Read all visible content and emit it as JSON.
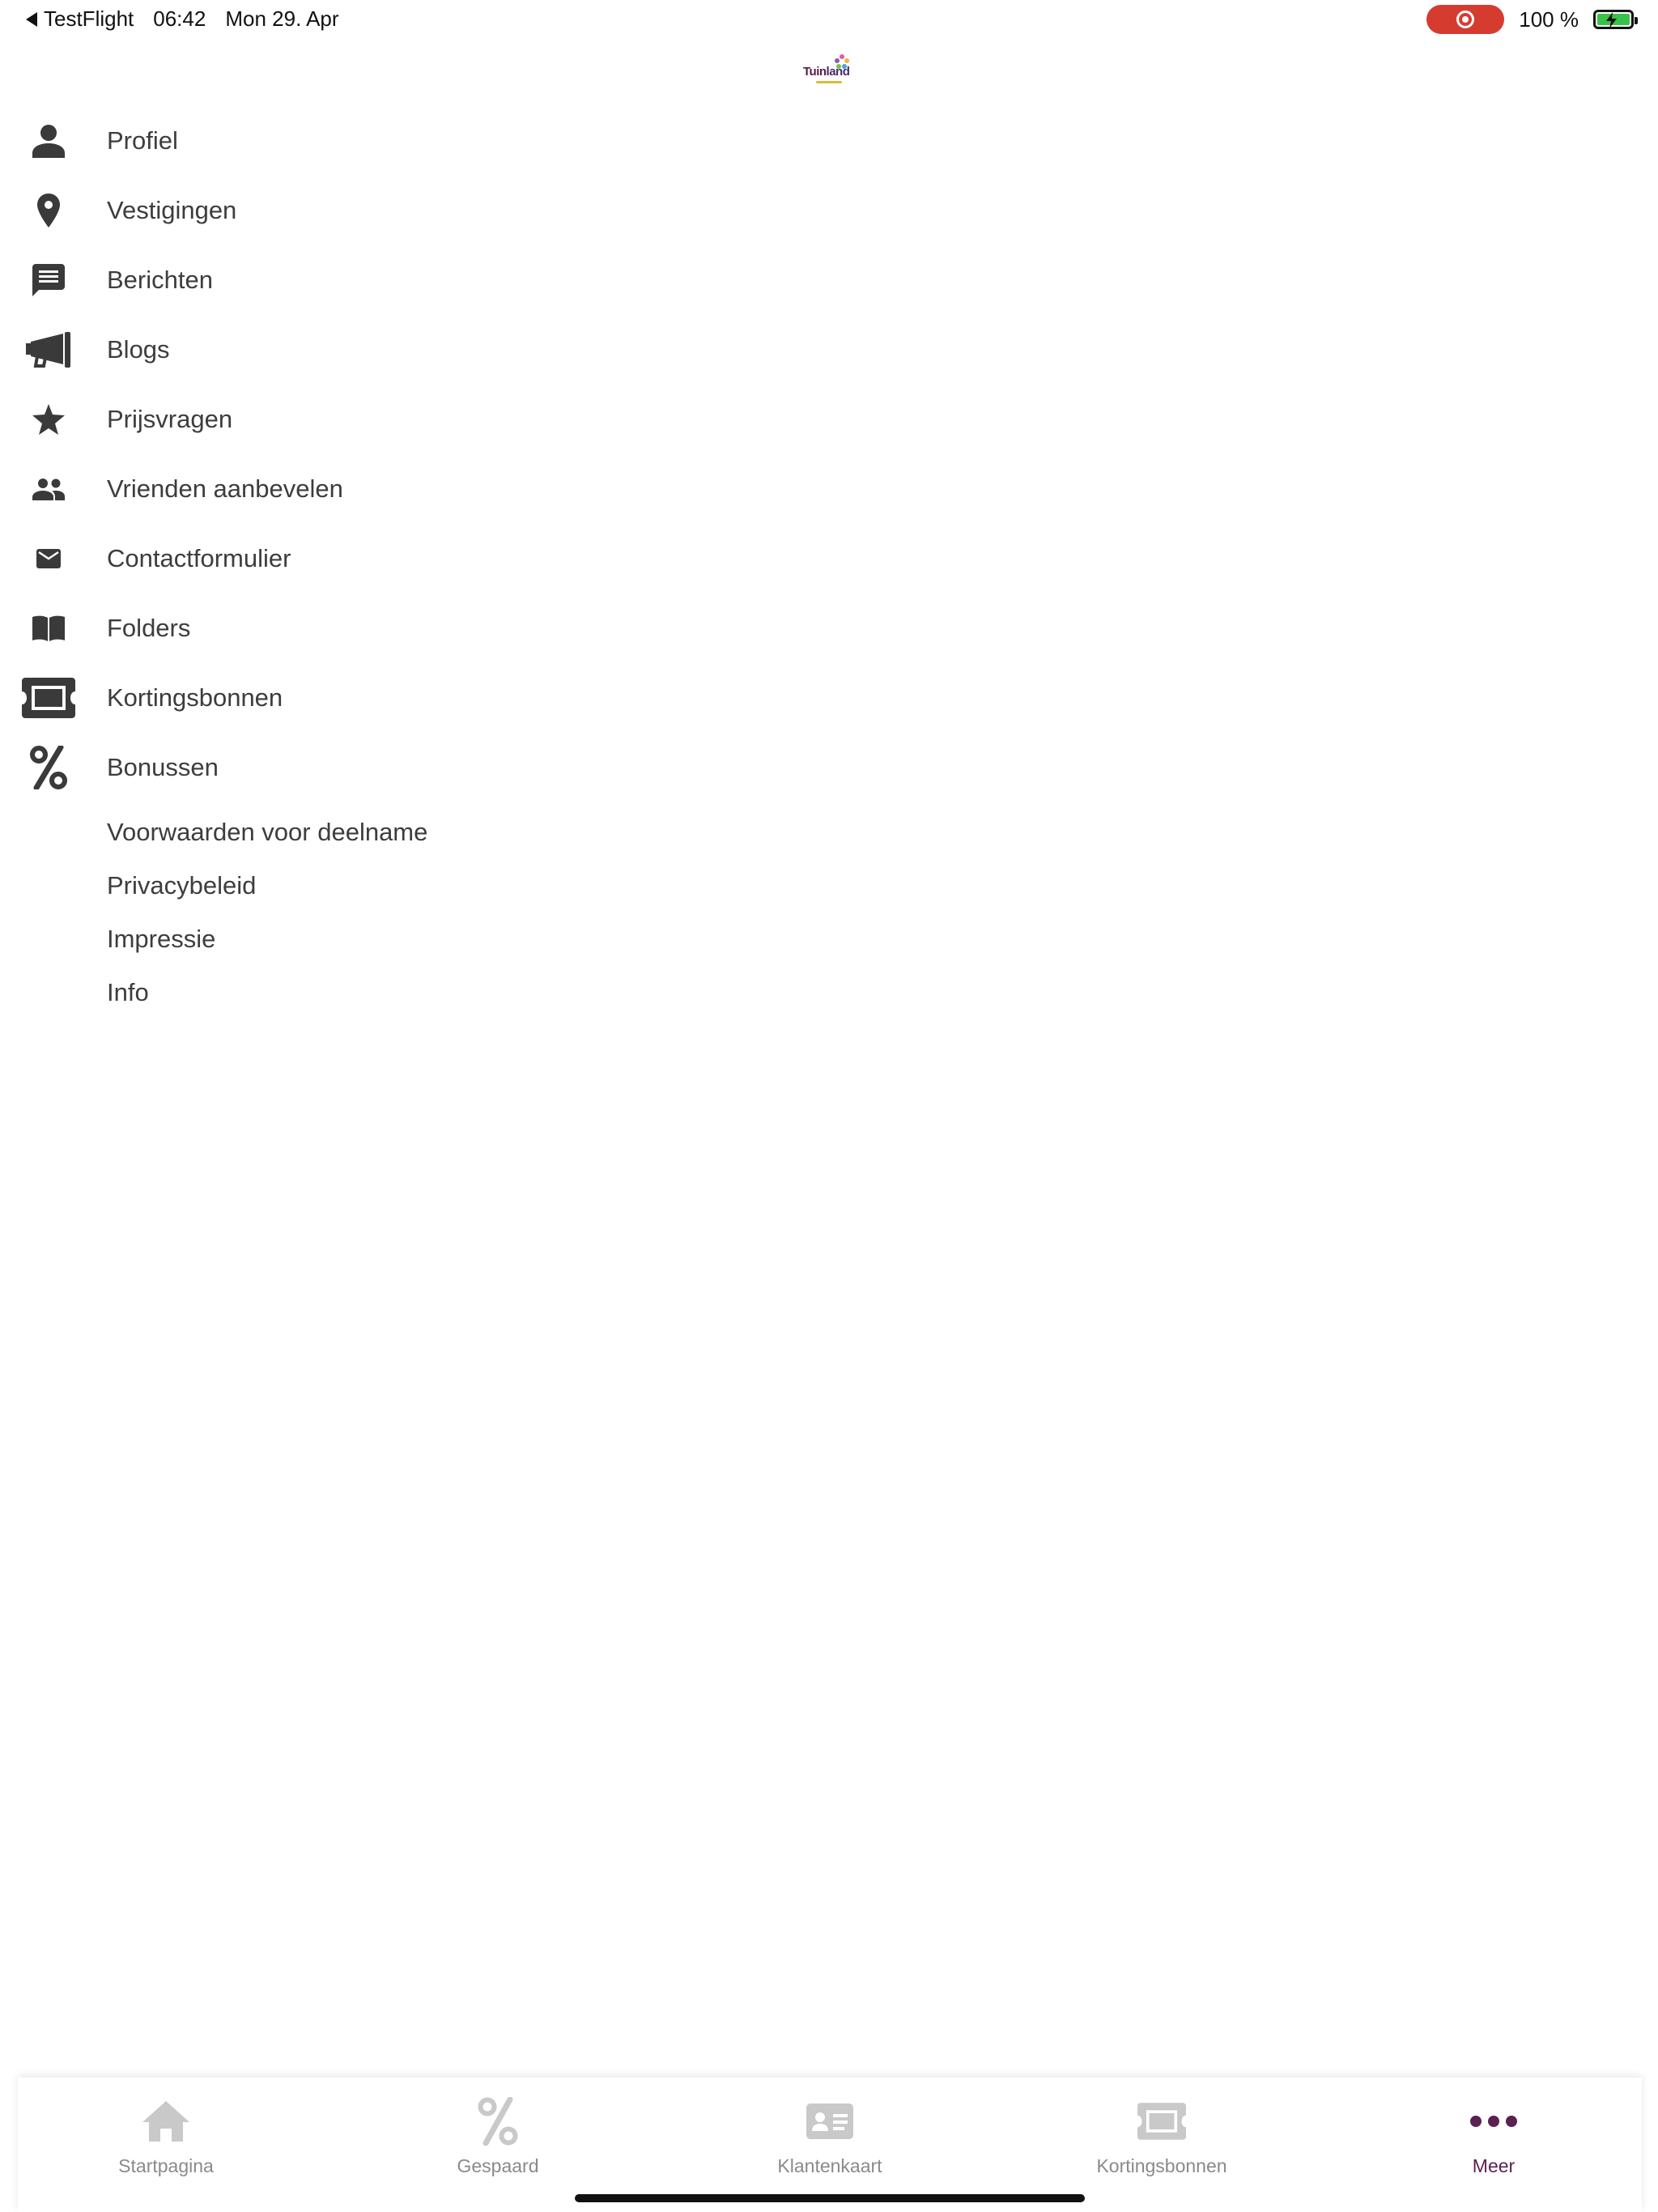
{
  "status_bar": {
    "back_app": "TestFlight",
    "time": "06:42",
    "date": "Mon 29. Apr",
    "battery": "100 %"
  },
  "logo": {
    "text_1": "Tuin",
    "text_2": "land"
  },
  "menu": {
    "items": [
      {
        "label": "Profiel",
        "icon": "person-icon"
      },
      {
        "label": "Vestigingen",
        "icon": "location-pin-icon"
      },
      {
        "label": "Berichten",
        "icon": "message-icon"
      },
      {
        "label": "Blogs",
        "icon": "megaphone-icon"
      },
      {
        "label": "Prijsvragen",
        "icon": "star-icon"
      },
      {
        "label": "Vrienden aanbevelen",
        "icon": "people-icon"
      },
      {
        "label": "Contactformulier",
        "icon": "envelope-icon"
      },
      {
        "label": "Folders",
        "icon": "book-icon"
      },
      {
        "label": "Kortingsbonnen",
        "icon": "ticket-icon"
      },
      {
        "label": "Bonussen",
        "icon": "percent-icon"
      }
    ],
    "secondary": [
      "Voorwaarden voor deelname",
      "Privacybeleid",
      "Impressie",
      "Info"
    ]
  },
  "tabbar": {
    "tabs": [
      {
        "label": "Startpagina",
        "icon": "home-icon"
      },
      {
        "label": "Gespaard",
        "icon": "percent-icon"
      },
      {
        "label": "Klantenkaart",
        "icon": "id-card-icon"
      },
      {
        "label": "Kortingsbonnen",
        "icon": "ticket-icon"
      },
      {
        "label": "Meer",
        "icon": "more-dots-icon",
        "active": true
      }
    ],
    "active_color": "#5b2150",
    "inactive_color": "#8a8a8a"
  }
}
